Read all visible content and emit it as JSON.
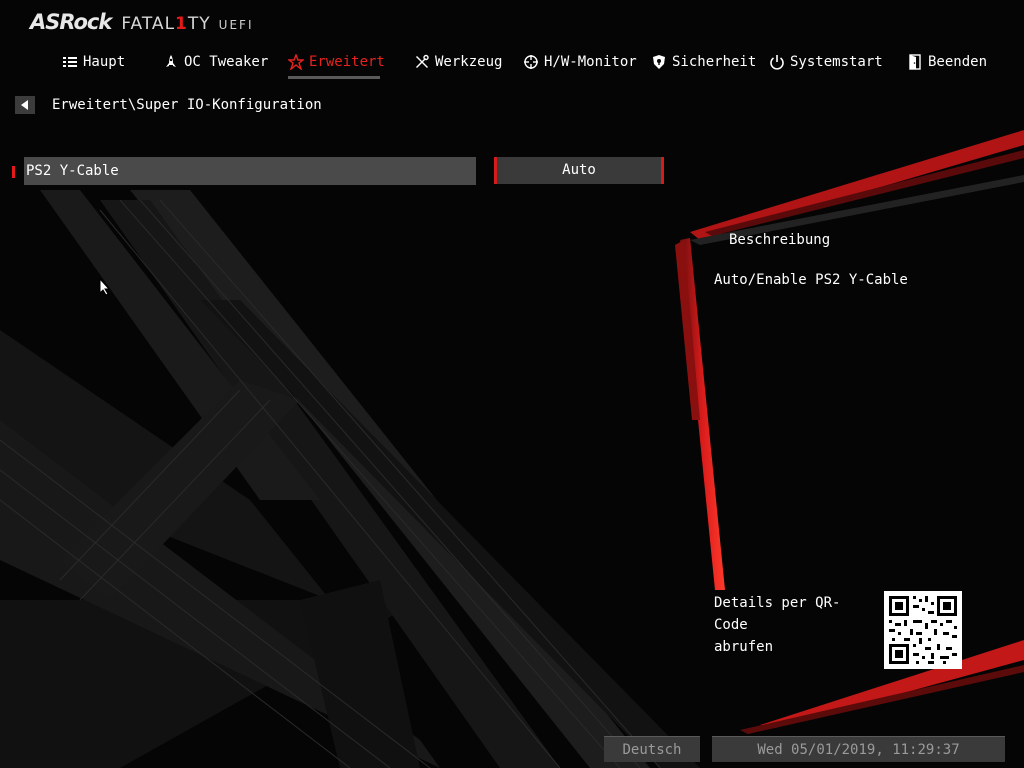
{
  "brand": {
    "asrock": "ASRock",
    "fatality_prefix": "FATAL",
    "fatality_one": "1",
    "fatality_suffix": "TY",
    "uefi": "UEFI"
  },
  "nav": [
    {
      "label": "Haupt",
      "icon": "list-icon",
      "active": false
    },
    {
      "label": "OC Tweaker",
      "icon": "rocket-icon",
      "active": false
    },
    {
      "label": "Erweitert",
      "icon": "star-icon",
      "active": true
    },
    {
      "label": "Werkzeug",
      "icon": "tools-icon",
      "active": false
    },
    {
      "label": "H/W-Monitor",
      "icon": "crosshair-icon",
      "active": false
    },
    {
      "label": "Sicherheit",
      "icon": "shield-icon",
      "active": false
    },
    {
      "label": "Systemstart",
      "icon": "power-icon",
      "active": false
    },
    {
      "label": "Beenden",
      "icon": "exit-door-icon",
      "active": false
    }
  ],
  "breadcrumb": "Erweitert\\Super IO-Konfiguration",
  "settings": [
    {
      "label": "PS2 Y-Cable",
      "value": "Auto"
    }
  ],
  "description": {
    "title": "Beschreibung",
    "text": "Auto/Enable PS2 Y-Cable"
  },
  "qr": {
    "text_line1": "Details per QR-Code",
    "text_line2": "abrufen"
  },
  "footer": {
    "language": "Deutsch",
    "datetime": "Wed 05/01/2019, 11:29:37"
  },
  "colors": {
    "accent": "#e21a1a",
    "background": "#060606",
    "selected_row": "#4a4a4a"
  }
}
